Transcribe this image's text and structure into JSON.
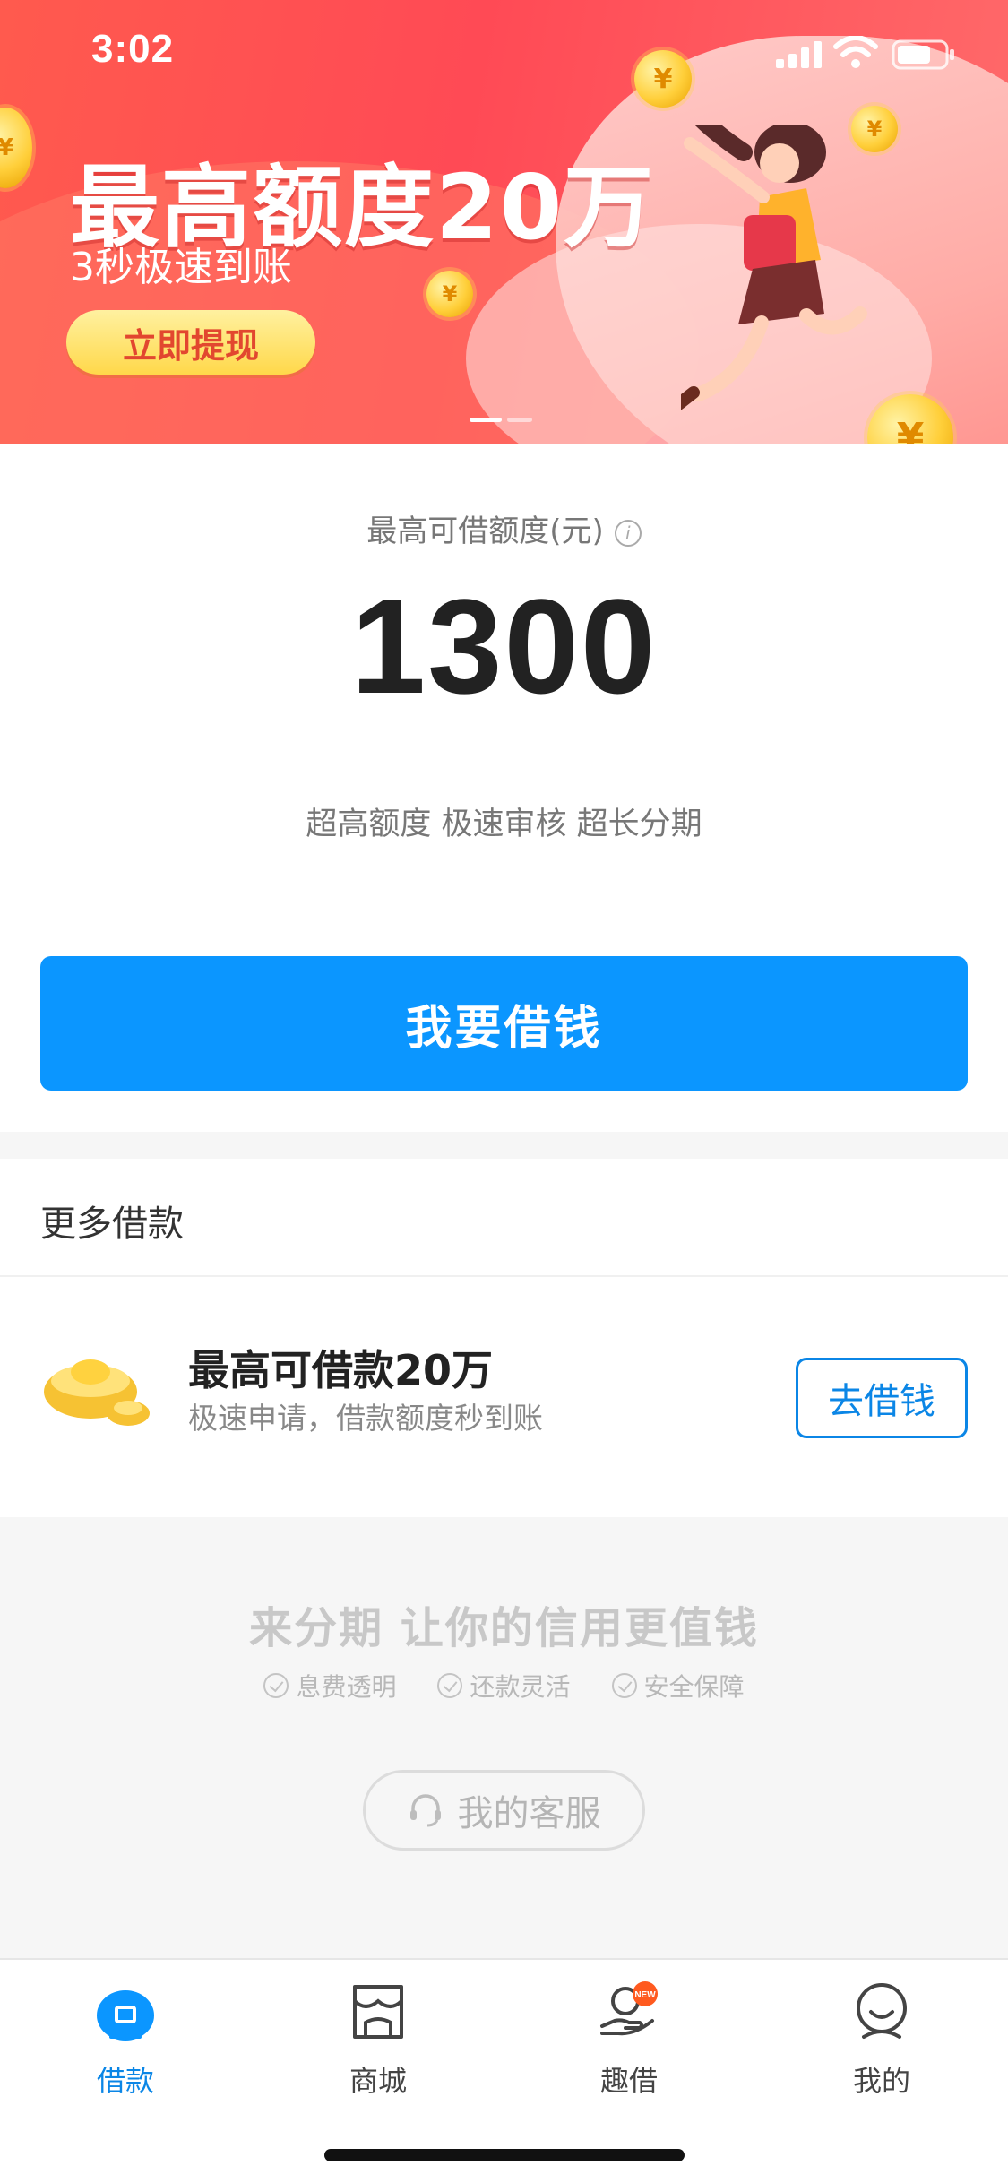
{
  "status_bar": {
    "time": "3:02"
  },
  "banner": {
    "headline": "最高额度20万",
    "subline": "3秒极速到账",
    "cta_label": "立即提现",
    "slides": 2,
    "active_slide": 0
  },
  "limit": {
    "label": "最高可借额度(元)",
    "info_icon": "info-icon",
    "value": "1300",
    "features": "超高额度 极速审核 超长分期"
  },
  "borrow_button": {
    "label": "我要借钱"
  },
  "more_loans": {
    "title": "更多借款",
    "item": {
      "title": "最高可借款20万",
      "subtitle": "极速申请，借款额度秒到账",
      "button_label": "去借钱"
    }
  },
  "promo": {
    "title": "来分期 让你的信用更值钱",
    "points": [
      "息费透明",
      "还款灵活",
      "安全保障"
    ],
    "service_label": "我的客服"
  },
  "tabbar": {
    "tabs": [
      {
        "label": "借款",
        "icon": "loan-icon",
        "active": true
      },
      {
        "label": "商城",
        "icon": "store-icon",
        "active": false
      },
      {
        "label": "趣借",
        "icon": "hand-coin-icon",
        "active": false,
        "badge": "NEW"
      },
      {
        "label": "我的",
        "icon": "profile-icon",
        "active": false
      }
    ]
  },
  "colors": {
    "primary": "#0b96ff",
    "banner_red": "#ff4a55",
    "accent_gold": "#ffd84a"
  }
}
